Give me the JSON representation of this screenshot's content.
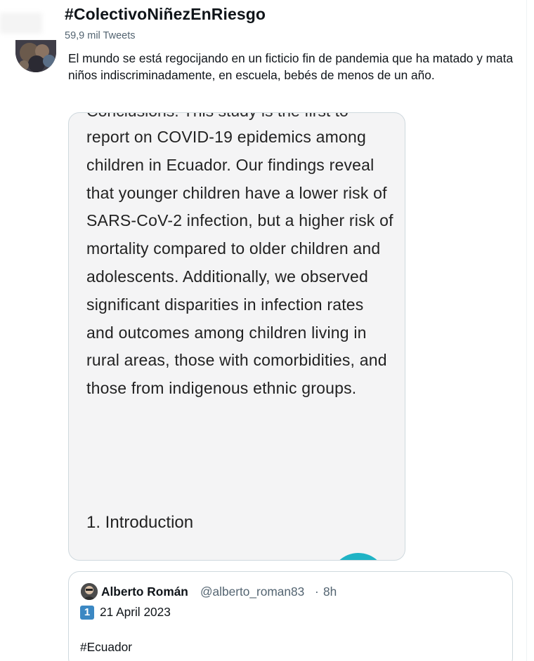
{
  "header": {
    "title": "#ColectivoNiñezEnRiesgo",
    "tweet_count": "59,9 mil Tweets"
  },
  "tweet": {
    "text": "El mundo se está regocijando en un ficticio fin de pandemia que ha matado y mata niños indiscriminadamente, en escuela, bebés de menos de un año.",
    "avatar_icon": "user-avatar"
  },
  "media": {
    "cut_line": "Conclusions: This study is the first to",
    "paragraph": "report on COVID-19 epidemics among children in Ecuador. Our findings reveal that younger children have a lower risk of SARS-CoV-2 infection, but a higher risk of mortality compared to older children and adolescents. Additionally, we observed significant disparities in infection rates and outcomes among children living in rural areas, those with comorbidities, and those from indigenous ethnic groups.",
    "heading": "1. Introduction",
    "fab_color": "#1fb3c5"
  },
  "quote": {
    "name": "Alberto Román",
    "handle": "@alberto_roman83",
    "separator": "·",
    "time": "8h",
    "badge": "1",
    "date": "21 April 2023",
    "hashtag": "#Ecuador",
    "avatar_icon": "user-avatar"
  },
  "colors": {
    "text_primary": "#0f1419",
    "text_secondary": "#536471",
    "border": "#cfd9de",
    "badge_blue": "#3b88c3"
  }
}
